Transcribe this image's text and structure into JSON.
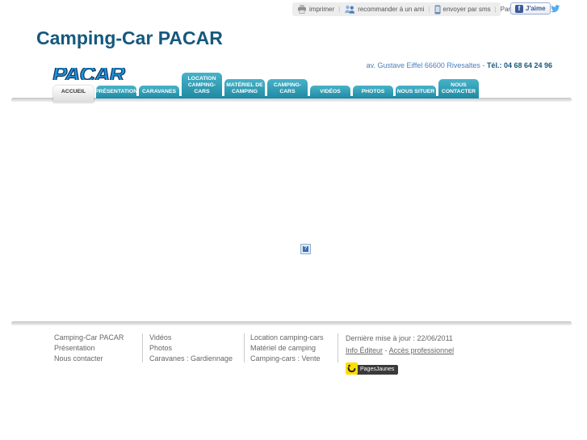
{
  "topbar": {
    "separator": "|",
    "print_label": "imprimer",
    "recommend_label": "recommander à un ami",
    "sms_label": "envoyer par sms",
    "share_label": "Partager sur",
    "like_label": "J'aime",
    "facebook_glyph": "f"
  },
  "header": {
    "title": "Camping-Car PACAR",
    "logo_text": "PACAR",
    "address": "av. Gustave Eiffel 66600 Rivesaltes",
    "address_separator": "-",
    "phone": "Tél.: 04 68 64 24 96"
  },
  "tabs": [
    {
      "label": "ACCUEIL",
      "active": true
    },
    {
      "label": "PRÉSENTATION",
      "active": false
    },
    {
      "label": "CARAVANES",
      "active": false
    },
    {
      "label": "LOCATION CAMPING-CARS",
      "active": false
    },
    {
      "label": "MATÉRIEL DE CAMPING",
      "active": false
    },
    {
      "label": "CAMPING-CARS",
      "active": false
    },
    {
      "label": "VIDÉOS",
      "active": false
    },
    {
      "label": "PHOTOS",
      "active": false
    },
    {
      "label": "NOUS SITUER",
      "active": false
    },
    {
      "label": "NOUS CONTACTER",
      "active": false
    }
  ],
  "content": {
    "broken_image_glyph": "?"
  },
  "footer": {
    "columns": [
      {
        "links": [
          "Camping-Car PACAR",
          "Présentation",
          "Nous contacter"
        ]
      },
      {
        "links": [
          "Vidéos",
          "Photos",
          "Caravanes : Gardiennage"
        ]
      },
      {
        "links": [
          "Location camping-cars",
          "Matériel de camping",
          "Camping-cars : Vente"
        ]
      }
    ],
    "last_update": "Dernière mise à jour : 22/06/2011",
    "info_editor_link": "Info Éditeur",
    "link_separator": "-",
    "pro_access_link": "Accès professionnel",
    "pagesjaunes_label": "PagesJaunes"
  },
  "colors": {
    "tab_teal": "#2596AE",
    "title_blue": "#15587E",
    "address_blue": "#4A7EBB",
    "facebook_blue": "#3B5998",
    "twitter_blue": "#55ACEE",
    "pagesjaunes_yellow": "#FFDD00"
  }
}
